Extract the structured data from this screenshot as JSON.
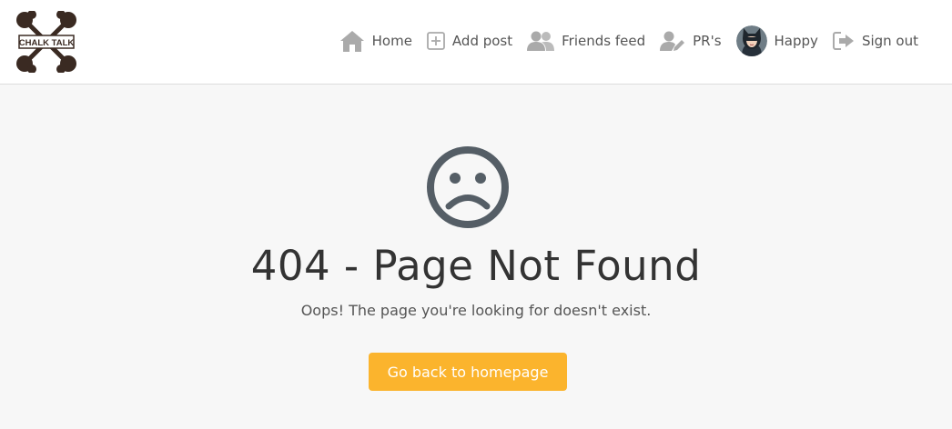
{
  "logo": {
    "text_line": "CHALK TALK",
    "icon": "dumbbell-cross-logo"
  },
  "nav": {
    "items": [
      {
        "label": "Home",
        "icon": "home-icon"
      },
      {
        "label": "Add post",
        "icon": "plus-square-icon"
      },
      {
        "label": "Friends feed",
        "icon": "users-icon"
      },
      {
        "label": "PR's",
        "icon": "user-edit-icon"
      },
      {
        "label": "Happy",
        "icon": "avatar"
      },
      {
        "label": "Sign out",
        "icon": "sign-out-icon"
      }
    ]
  },
  "error": {
    "icon": "sad-face-icon",
    "title": "404 - Page Not Found",
    "message": "Oops! The page you're looking for doesn't exist.",
    "button_label": "Go back to homepage"
  },
  "colors": {
    "accent": "#fbb42d",
    "icon_gray": "#aaaaaa",
    "face_gray": "#555e66",
    "background": "#f7f7f7"
  }
}
